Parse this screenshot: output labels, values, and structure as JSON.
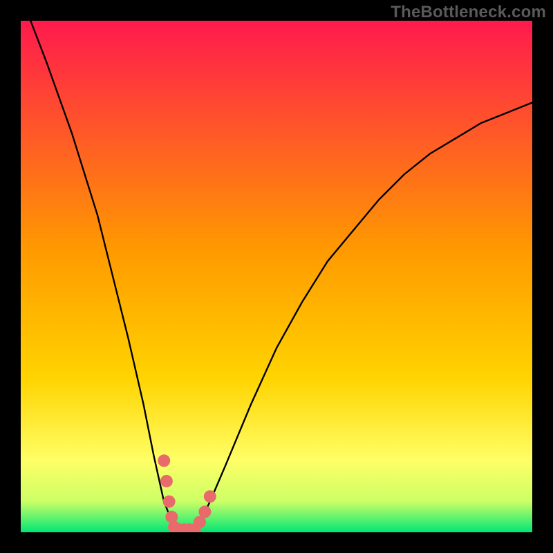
{
  "watermark": "TheBottleneck.com",
  "colors": {
    "frame": "#000000",
    "grad_top": "#ff1a4d",
    "grad_mid": "#ffd400",
    "grad_low": "#ffff66",
    "grad_green": "#00e676",
    "curve": "#000000",
    "highlight": "#e86a6a"
  },
  "chart_data": {
    "type": "line",
    "title": "",
    "xlabel": "",
    "ylabel": "",
    "xlim": [
      0,
      100
    ],
    "ylim": [
      0,
      100
    ],
    "series": [
      {
        "name": "bottleneck-curve",
        "x": [
          0,
          5,
          10,
          15,
          18,
          21,
          24,
          26,
          28,
          30,
          31,
          32,
          33,
          35,
          37,
          40,
          45,
          50,
          55,
          60,
          65,
          70,
          75,
          80,
          85,
          90,
          95,
          100
        ],
        "y": [
          105,
          92,
          78,
          62,
          50,
          38,
          25,
          15,
          6,
          1,
          0,
          0,
          0,
          2,
          6,
          13,
          25,
          36,
          45,
          53,
          59,
          65,
          70,
          74,
          77,
          80,
          82,
          84
        ]
      }
    ],
    "annotations": [
      {
        "name": "highlight-v",
        "points": [
          [
            28.0,
            14
          ],
          [
            28.5,
            10
          ],
          [
            29.0,
            6
          ],
          [
            29.5,
            3
          ],
          [
            30.0,
            1
          ],
          [
            31.0,
            0.5
          ],
          [
            32.0,
            0.5
          ],
          [
            33.0,
            0.5
          ],
          [
            34.0,
            0.5
          ],
          [
            35.0,
            2
          ],
          [
            36.0,
            4
          ],
          [
            37.0,
            7
          ]
        ]
      }
    ]
  }
}
